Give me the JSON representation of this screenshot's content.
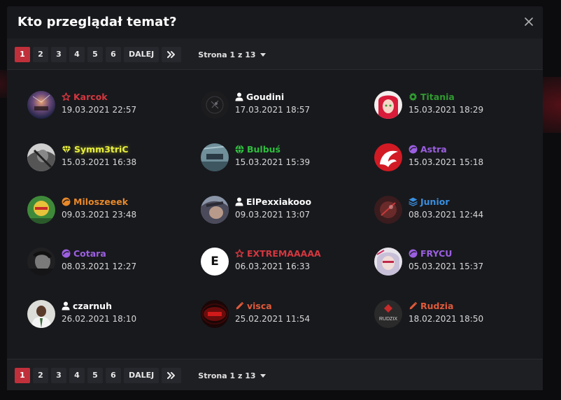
{
  "modal": {
    "title": "Kto przeglądał temat?",
    "close_symbol": "✕"
  },
  "pagination": {
    "pages": [
      "1",
      "2",
      "3",
      "4",
      "5",
      "6"
    ],
    "active_page": "1",
    "next_label": "DALEJ",
    "last_icon": "double-chevron-right-icon",
    "status": "Strona 1 z 13"
  },
  "viewers": [
    {
      "name": "Karcok",
      "date": "19.03.2021 22:57",
      "color": "#d4373f",
      "icon": "star-outline-icon"
    },
    {
      "name": "Goudini",
      "date": "17.03.2021 18:57",
      "color": "#ffffff",
      "icon": "user-icon"
    },
    {
      "name": "Titania",
      "date": "15.03.2021 18:29",
      "color": "#2f9a2f",
      "icon": "gear-icon"
    },
    {
      "name": "Symm3triC",
      "date": "15.03.2021 16:38",
      "color": "#e8ef3c",
      "icon": "diamond-icon"
    },
    {
      "name": "Bulbuś",
      "date": "15.03.2021 15:39",
      "color": "#2fbf3f",
      "icon": "globe-icon"
    },
    {
      "name": "Astra",
      "date": "15.03.2021 15:18",
      "color": "#9b5fe0",
      "icon": "disc-icon"
    },
    {
      "name": "Miloszeeek",
      "date": "09.03.2021 23:48",
      "color": "#e8892a",
      "icon": "disc-icon"
    },
    {
      "name": "ElPexxiakooo",
      "date": "09.03.2021 13:07",
      "color": "#ffffff",
      "icon": "user-icon"
    },
    {
      "name": "Junior",
      "date": "08.03.2021 12:44",
      "color": "#3a8fe0",
      "icon": "layers-icon"
    },
    {
      "name": "Cotara",
      "date": "08.03.2021 12:27",
      "color": "#9b5fe0",
      "icon": "disc-icon"
    },
    {
      "name": "EXTREMAAAAA",
      "date": "06.03.2021 16:33",
      "color": "#d4373f",
      "icon": "star-outline-icon"
    },
    {
      "name": "FRYCU",
      "date": "05.03.2021 15:37",
      "color": "#9b5fe0",
      "icon": "disc-icon"
    },
    {
      "name": "czarnuh",
      "date": "26.02.2021 18:10",
      "color": "#ffffff",
      "icon": "user-icon"
    },
    {
      "name": "visca",
      "date": "25.02.2021 11:54",
      "color": "#e05a3a",
      "icon": "pencil-icon"
    },
    {
      "name": "Rudzia",
      "date": "18.02.2021 18:50",
      "color": "#e05a3a",
      "icon": "pencil-icon"
    }
  ],
  "avatar_texts": {
    "extremaaaaa": "E",
    "rudzia": "RUDZIX"
  }
}
